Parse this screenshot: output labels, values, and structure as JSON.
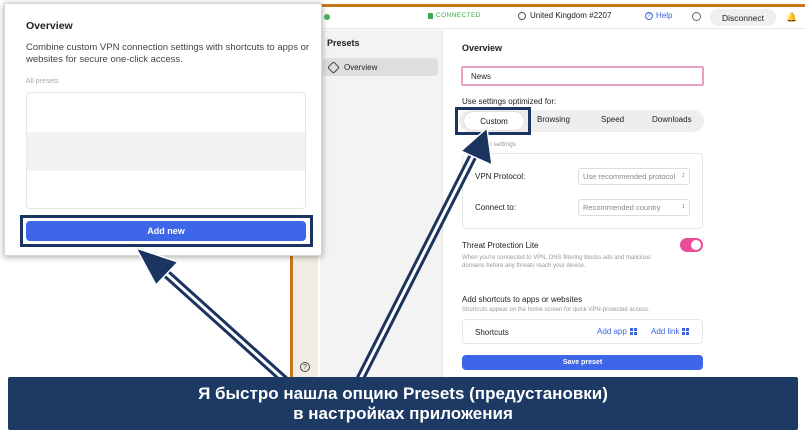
{
  "topbar": {
    "status": "CONNECTED",
    "server": "United Kingdom #2207",
    "help": "Help",
    "disconnect": "Disconnect"
  },
  "sidebar": {
    "title": "Presets",
    "items": [
      {
        "label": "Overview"
      }
    ]
  },
  "main": {
    "title": "Overview",
    "preset_name": "News",
    "optimized_label": "Use settings optimized for:",
    "modes": [
      "Custom",
      "Browsing",
      "Speed",
      "Downloads"
    ],
    "selected_mode": "Custom",
    "connection_settings_label": "ction settings",
    "vpn_protocol_label": "VPN Protocol:",
    "vpn_protocol_value": "Use recommended protocol",
    "connect_to_label": "Connect to:",
    "connect_to_value": "Recommended country",
    "threat_title": "Threat Protection Lite",
    "threat_desc": "When you're connected to VPN, DNS filtering blocks ads and malicious domains before any threats reach your device.",
    "threat_enabled": true,
    "shortcuts_title": "Add shortcuts to apps or websites",
    "shortcuts_desc": "Shortcuts appear on the home screen for quick VPN-protected access.",
    "shortcuts_label": "Shortcuts",
    "add_app": "Add app",
    "add_link": "Add link",
    "save_preset": "Save preset"
  },
  "overlay": {
    "title": "Overview",
    "description": "Combine custom VPN connection settings with shortcuts to apps or websites for secure one-click access.",
    "list_label": "All presets",
    "add_new": "Add new"
  },
  "caption": {
    "line1": "Я быстро нашла опцию Presets (предустановки)",
    "line2": "в настройках приложения"
  },
  "colors": {
    "accent_blue": "#3d66e8",
    "frame_navy": "#1b3560",
    "caption_bg": "#1d3a64",
    "toggle_pink": "#ea4d95",
    "connected_green": "#3aa84a"
  }
}
